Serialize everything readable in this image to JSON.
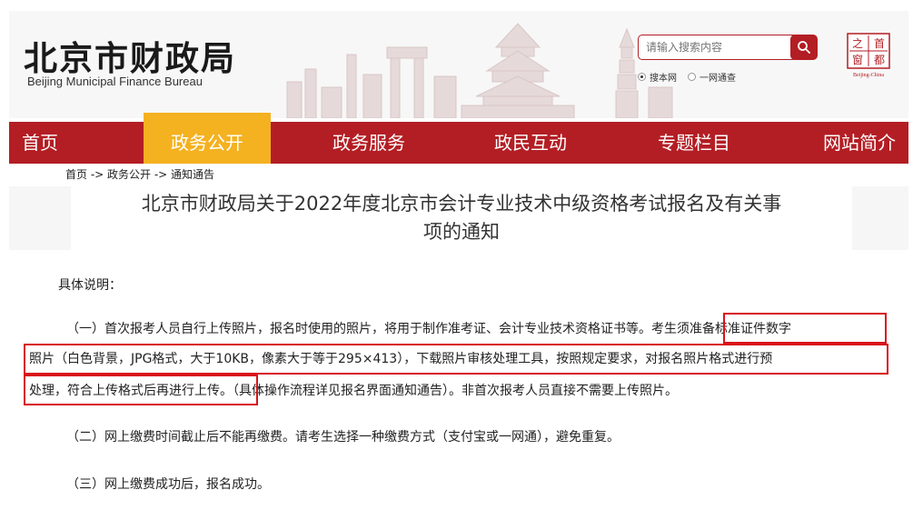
{
  "header": {
    "logo_cn": "北京市财政局",
    "logo_en": "Beijing Municipal Finance Bureau",
    "search": {
      "placeholder": "请输入搜索内容"
    },
    "scope": {
      "options": [
        "搜本网",
        "一网通查"
      ],
      "selected": "搜本网"
    },
    "seal": {
      "chars": [
        "之",
        "首",
        "窗",
        "都"
      ],
      "caption": "Beijing-China"
    }
  },
  "nav": {
    "items": [
      "首页",
      "政务公开",
      "政务服务",
      "政民互动",
      "专题栏目",
      "网站简介"
    ],
    "active": "政务公开"
  },
  "breadcrumb": "首页 -> 政务公开 -> 通知通告",
  "article": {
    "title_line1": "北京市财政局关于2022年度北京市会计专业技术中级资格考试报名及有关事",
    "title_line2": "项的通知",
    "section_heading": "具体说明：",
    "item1": {
      "part_a": "（一）首次报考人员自行上传照片，报名时使用的照片，将用于制作准考证、会计专业技术资格证书等。",
      "highlight_1": "考生须准备标准证件数字",
      "highlight_2": "照片（白色背景，JPG格式，大于10KB，像素大于等于295×413），下载照片审核处理工具，按照规定要求，对报名照片格式进行预",
      "highlight_3": "处理，符合上传格式后再进行上传。",
      "part_b": "（具体操作流程详见报名界面通知通告）。非首次报考人员直接不需要上传照片。"
    },
    "item2": "（二）网上缴费时间截止后不能再缴费。请考生选择一种缴费方式（支付宝或一网通），避免重复。",
    "item3": "（三）网上缴费成功后，报名成功。"
  },
  "colors": {
    "brand_red": "#b31e24",
    "active_tab": "#f4b120",
    "highlight_border": "#d8141b"
  }
}
